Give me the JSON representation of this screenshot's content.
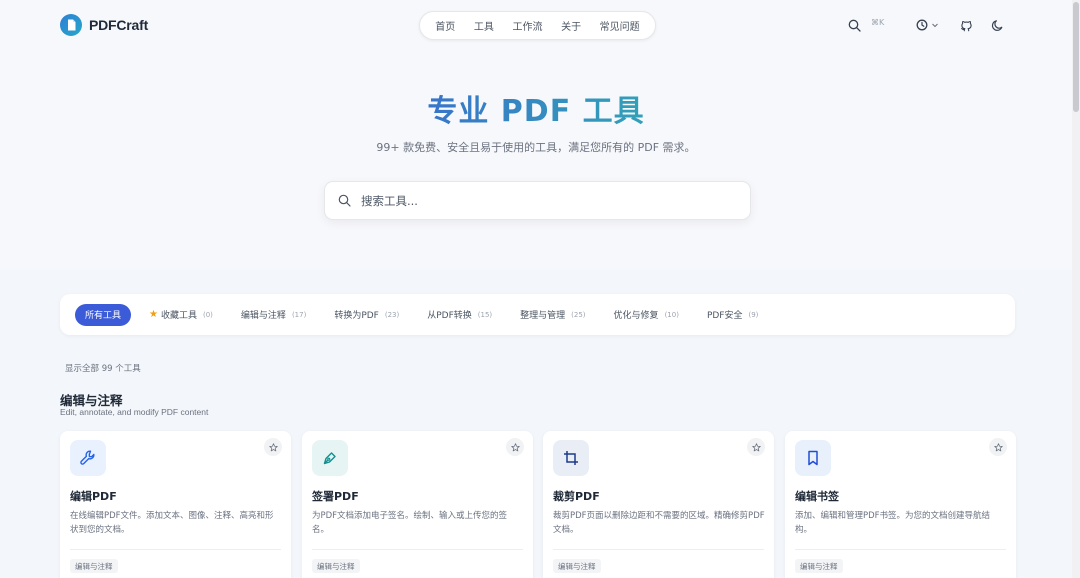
{
  "app": {
    "name": "PDFCraft"
  },
  "nav": {
    "items": [
      "首页",
      "工具",
      "工作流",
      "关于",
      "常见问题"
    ]
  },
  "header": {
    "shortcut": "⌘K"
  },
  "hero": {
    "title": "专业 PDF 工具",
    "subtitle": "99+ 款免费、安全且易于使用的工具，满足您所有的 PDF 需求。",
    "search_placeholder": "搜索工具..."
  },
  "tabs": [
    {
      "label": "所有工具",
      "count": "",
      "active": true
    },
    {
      "label": "收藏工具",
      "count": "(0)"
    },
    {
      "label": "编辑与注释",
      "count": "(17)"
    },
    {
      "label": "转换为PDF",
      "count": "(23)"
    },
    {
      "label": "从PDF转换",
      "count": "(15)"
    },
    {
      "label": "整理与管理",
      "count": "(25)"
    },
    {
      "label": "优化与修复",
      "count": "(10)"
    },
    {
      "label": "PDF安全",
      "count": "(9)"
    }
  ],
  "showing": "显示全部 99 个工具",
  "section": {
    "title": "编辑与注释",
    "subtitle": "Edit, annotate, and modify PDF content"
  },
  "cards": [
    {
      "title": "编辑PDF",
      "desc": "在线编辑PDF文件。添加文本、图像、注释、高亮和形状到您的文档。",
      "tag": "编辑与注释",
      "icon": "wrench-icon",
      "icon_bg": "#e8f1fd",
      "icon_color": "#2563eb"
    },
    {
      "title": "签署PDF",
      "desc": "为PDF文档添加电子签名。绘制、输入或上传您的签名。",
      "tag": "编辑与注释",
      "icon": "pen-icon",
      "icon_bg": "#e6f4f4",
      "icon_color": "#0f8f8f"
    },
    {
      "title": "裁剪PDF",
      "desc": "裁剪PDF页面以删除边距和不需要的区域。精确修剪PDF文档。",
      "tag": "编辑与注释",
      "icon": "crop-icon",
      "icon_bg": "#e9eef6",
      "icon_color": "#1e3a8a"
    },
    {
      "title": "编辑书签",
      "desc": "添加、编辑和管理PDF书签。为您的文档创建导航结构。",
      "tag": "编辑与注释",
      "icon": "bookmark-icon",
      "icon_bg": "#e8f0fb",
      "icon_color": "#1d4ed8"
    }
  ],
  "colors": {
    "accent": "#3b5bd8",
    "title_gradient_start": "#3b5fd0",
    "title_gradient_end": "#2fb6b0"
  }
}
